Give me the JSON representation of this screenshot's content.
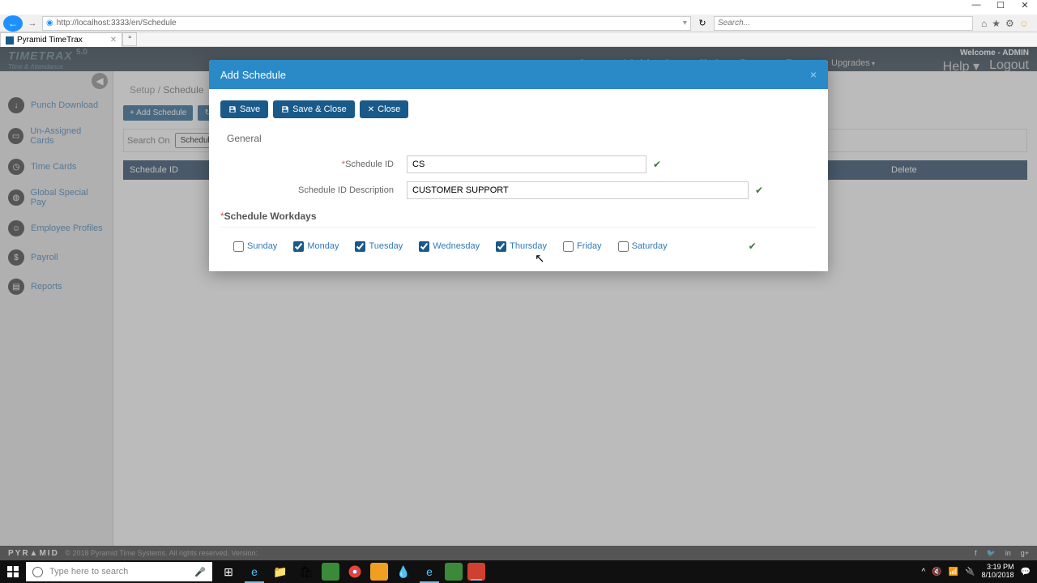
{
  "window": {
    "url": "http://localhost:3333/en/Schedule",
    "search_placeholder": "Search...",
    "tab_title": "Pyramid TimeTrax"
  },
  "header": {
    "logo": "TIMETRAX",
    "version": "5.0",
    "tagline": "Time & Attendance",
    "welcome": "Welcome - ADMIN",
    "help": "Help",
    "logout": "Logout"
  },
  "nav": {
    "items": [
      "Setup",
      "Administration",
      "Clock",
      "Reports",
      "Export",
      "Upgrades"
    ]
  },
  "sidebar": {
    "items": [
      {
        "icon": "↓",
        "label": "Punch Download"
      },
      {
        "icon": "▭",
        "label": "Un-Assigned Cards"
      },
      {
        "icon": "🕐",
        "label": "Time Cards"
      },
      {
        "icon": "🌐",
        "label": "Global Special Pay"
      },
      {
        "icon": "👤",
        "label": "Employee Profiles"
      },
      {
        "icon": "$",
        "label": "Payroll"
      },
      {
        "icon": "▤",
        "label": "Reports"
      }
    ]
  },
  "breadcrumb": {
    "parent": "Setup",
    "sep": "/",
    "current": "Schedule"
  },
  "actions": {
    "add": "+ Add Schedule",
    "refresh": "↻ Refresh"
  },
  "search_on": {
    "label": "Search On",
    "option": "Schedule ID"
  },
  "table": {
    "col1": "Schedule ID",
    "col2": "Delete"
  },
  "modal": {
    "title": "Add Schedule",
    "buttons": {
      "save": "Save",
      "save_close": "Save & Close",
      "close": "Close"
    },
    "tab": "General",
    "fields": {
      "id_label": "Schedule ID",
      "id_value": "CS",
      "desc_label": "Schedule ID Description",
      "desc_value": "CUSTOMER SUPPORT"
    },
    "workdays_header": "Schedule Workdays",
    "workdays": [
      {
        "label": "Sunday",
        "checked": false
      },
      {
        "label": "Monday",
        "checked": true
      },
      {
        "label": "Tuesday",
        "checked": true
      },
      {
        "label": "Wednesday",
        "checked": true
      },
      {
        "label": "Thursday",
        "checked": true
      },
      {
        "label": "Friday",
        "checked": false
      },
      {
        "label": "Saturday",
        "checked": false
      }
    ]
  },
  "footer": {
    "brand": "PYRAMID",
    "copyright": "© 2018 Pyramid Time Systems. All rights reserved.   Version:"
  },
  "taskbar": {
    "search_placeholder": "Type here to search",
    "time": "3:19 PM",
    "date": "8/10/2018"
  }
}
